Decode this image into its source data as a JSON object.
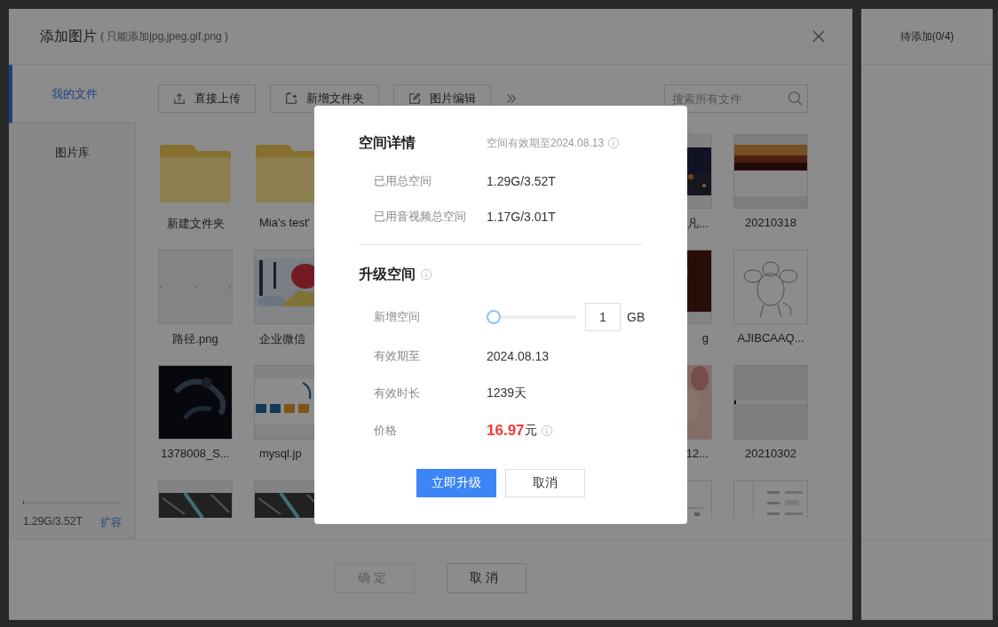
{
  "dialog": {
    "title": "添加图片",
    "subtitle": "( 只能添加jpg,jpeg,gif,png )"
  },
  "sidebar": {
    "items": [
      {
        "label": "我的文件",
        "selected": true
      },
      {
        "label": "图片库",
        "selected": false
      }
    ],
    "storage": {
      "level": 0.01,
      "text": "1.29G/3.52T",
      "link": "扩容"
    }
  },
  "toolbar": {
    "buttons": [
      {
        "kind": "upload",
        "label": "直接上传"
      },
      {
        "kind": "new_folder",
        "label": "新增文件夹"
      },
      {
        "kind": "edit",
        "label": "图片编辑"
      }
    ],
    "search": {
      "placeholder": "搜索所有文件"
    }
  },
  "file_rows": [
    {
      "items": [
        {
          "kind": "folder",
          "label": "新建文件夹"
        },
        {
          "kind": "folder",
          "label": "Mia's test'"
        },
        {
          "kind": "picture",
          "label": "凡..."
        },
        {
          "kind": "picture",
          "label": "20210318"
        }
      ]
    },
    {
      "items": [
        {
          "kind": "blank",
          "label": "路径.png"
        },
        {
          "kind": "picture",
          "label": "企业微信"
        },
        {
          "kind": "picture",
          "label": "g"
        },
        {
          "kind": "picture",
          "label": "AJIBCAAQ..."
        }
      ]
    },
    {
      "items": [
        {
          "kind": "picture",
          "label": "1378008_S..."
        },
        {
          "kind": "picture",
          "label": "mysql.jp"
        },
        {
          "kind": "picture",
          "label": "12..."
        },
        {
          "kind": "picture",
          "label": "20210302"
        }
      ]
    },
    {
      "items": [
        {
          "kind": "picture"
        },
        {
          "kind": "picture"
        },
        {
          "kind": "picture"
        },
        {
          "kind": "picture"
        }
      ]
    }
  ],
  "footer_buttons": [
    {
      "label": "确定",
      "disabled": true
    },
    {
      "label": "取消",
      "disabled": false
    }
  ],
  "pending_panel": {
    "title": "待添加(0/4)"
  },
  "space_dialog": {
    "details": {
      "title": "空间详情",
      "note": "空间有效期至2024.08.13",
      "rows": [
        {
          "label": "已用总空间",
          "value": "1.29G/3.52T"
        },
        {
          "label": "已用音视频总空间",
          "value": "1.17G/3.01T"
        }
      ]
    },
    "upgrade": {
      "title": "升级空间",
      "rows": [
        {
          "kind": "slider",
          "label": "新增空间",
          "level": 0,
          "value": "1",
          "unit": "GB"
        },
        {
          "kind": "text",
          "label": "有效期至",
          "value": "2024.08.13"
        },
        {
          "kind": "text",
          "label": "有效时长",
          "value": "1239天"
        },
        {
          "kind": "price",
          "label": "价格",
          "value": "16.97",
          "unit": "元"
        }
      ]
    },
    "buttons": [
      {
        "kind": "primary",
        "label": "立即升级"
      },
      {
        "kind": "default",
        "label": "取消"
      }
    ]
  }
}
